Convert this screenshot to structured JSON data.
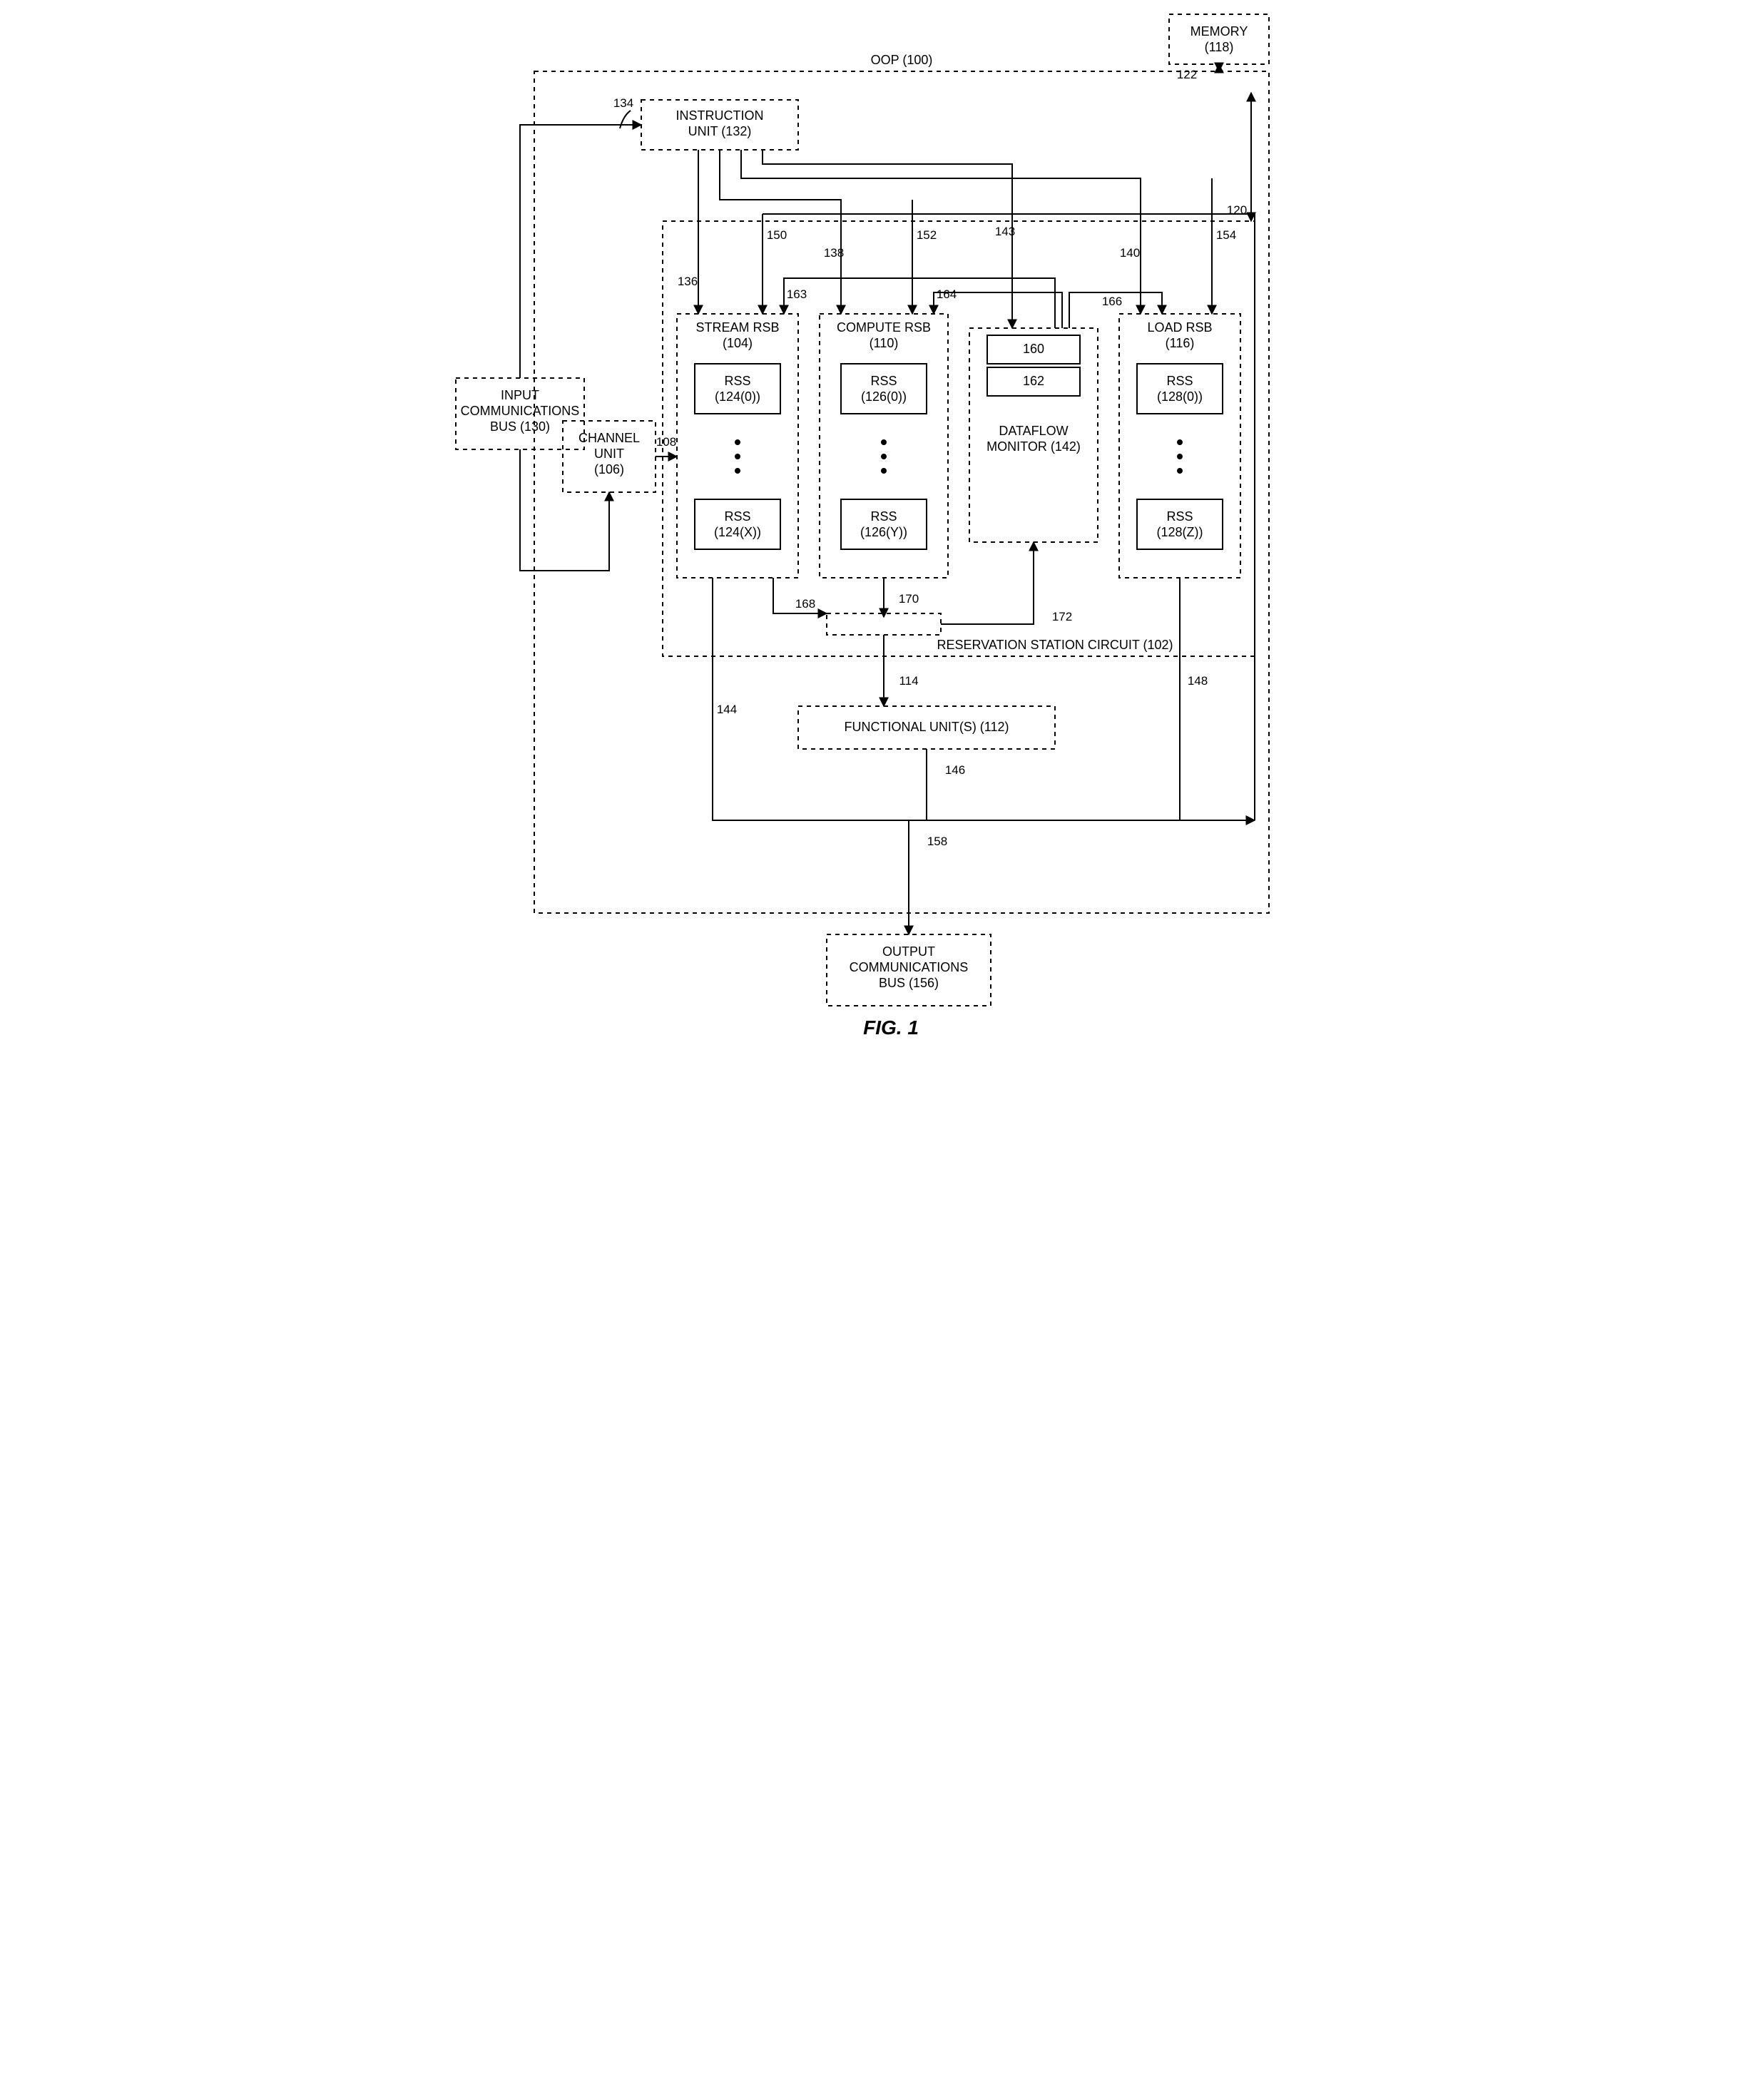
{
  "figure_label": "FIG. 1",
  "outer": {
    "title": "OOP (100)"
  },
  "blocks": {
    "input_bus": {
      "l1": "INPUT",
      "l2": "COMMUNICATIONS",
      "l3": "BUS (130)"
    },
    "instruction": {
      "l1": "INSTRUCTION",
      "l2": "UNIT (132)"
    },
    "memory": {
      "l1": "MEMORY",
      "l2": "(118)"
    },
    "channel": {
      "l1": "CHANNEL",
      "l2": "UNIT",
      "l3": "(106)"
    },
    "reservation": {
      "label": "RESERVATION STATION CIRCUIT (102)"
    },
    "stream": {
      "l1": "STREAM RSB",
      "l2": "(104)",
      "r0": "RSS",
      "r0p": "(124(0))",
      "rX": "RSS",
      "rXp": "(124(X))"
    },
    "compute": {
      "l1": "COMPUTE RSB",
      "l2": "(110)",
      "r0": "RSS",
      "r0p": "(126(0))",
      "rY": "RSS",
      "rYp": "(126(Y))"
    },
    "load": {
      "l1": "LOAD RSB",
      "l2": "(116)",
      "r0": "RSS",
      "r0p": "(128(0))",
      "rZ": "RSS",
      "rZp": "(128(Z))"
    },
    "dataflow": {
      "l1": "DATAFLOW",
      "l2": "MONITOR (142)",
      "sub1": "160",
      "sub2": "162"
    },
    "functional": {
      "label": "FUNCTIONAL UNIT(S) (112)"
    },
    "output_bus": {
      "l1": "OUTPUT",
      "l2": "COMMUNICATIONS",
      "l3": "BUS (156)"
    }
  },
  "labels": {
    "l108": "108",
    "l114": "114",
    "l120": "120",
    "l122": "122",
    "l134": "134",
    "l136": "136",
    "l138": "138",
    "l140": "140",
    "l143": "143",
    "l144": "144",
    "l146": "146",
    "l148": "148",
    "l150": "150",
    "l152": "152",
    "l154": "154",
    "l158": "158",
    "l163": "163",
    "l164": "164",
    "l166": "166",
    "l168": "168",
    "l170": "170",
    "l172": "172"
  }
}
